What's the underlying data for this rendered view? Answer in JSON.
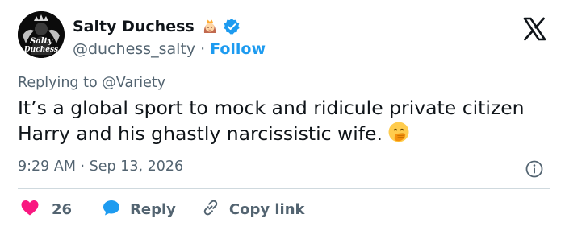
{
  "author": {
    "display_name": "Salty Duchess",
    "handle": "@duchess_salty",
    "separator": "·",
    "follow_label": "Follow",
    "avatar_text_line1": "Salty",
    "avatar_text_line2": "Duchess",
    "badge_emoji": "princess-emoji",
    "verified": true
  },
  "tweet": {
    "replying_prefix": "Replying to",
    "replying_to": "@Variety",
    "text": "It’s a global sport to mock and ridicule private citizen Harry and his ghastly narcissistic wife.",
    "emoji": "face-with-hand-over-mouth-emoji",
    "time": "9:29 AM",
    "meta_separator": "·",
    "date": "Sep 13, 2026"
  },
  "actions": {
    "likes": "26",
    "reply_label": "Reply",
    "copy_label": "Copy link"
  },
  "colors": {
    "accent": "#1d9bf0",
    "like": "#f91880",
    "muted_text": "#536471",
    "primary_text": "#0f1419",
    "divider": "#cfd9de"
  }
}
